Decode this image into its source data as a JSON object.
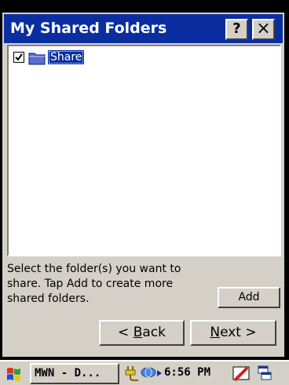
{
  "window": {
    "title": "My Shared Folders",
    "help_label": "?",
    "close_label": "×"
  },
  "folders": [
    {
      "label": "Share",
      "checked": true,
      "selected": true
    }
  ],
  "instructions": "Select the folder(s) you want to share.  Tap Add to create more shared folders.",
  "buttons": {
    "add": "Add",
    "back": "< Back",
    "next": "Next >"
  },
  "taskbar": {
    "start_icon": "windows-flag-icon",
    "task_label": "MWN - D...",
    "clock": "6:56 PM",
    "tray_icons": [
      "power-plug-icon",
      "network-icon",
      "pen-input-icon",
      "windows-switch-icon"
    ]
  },
  "colors": {
    "titlebar": "#0a2ea0",
    "selection": "#0a2ea0",
    "chrome": "#d4d0c8"
  }
}
